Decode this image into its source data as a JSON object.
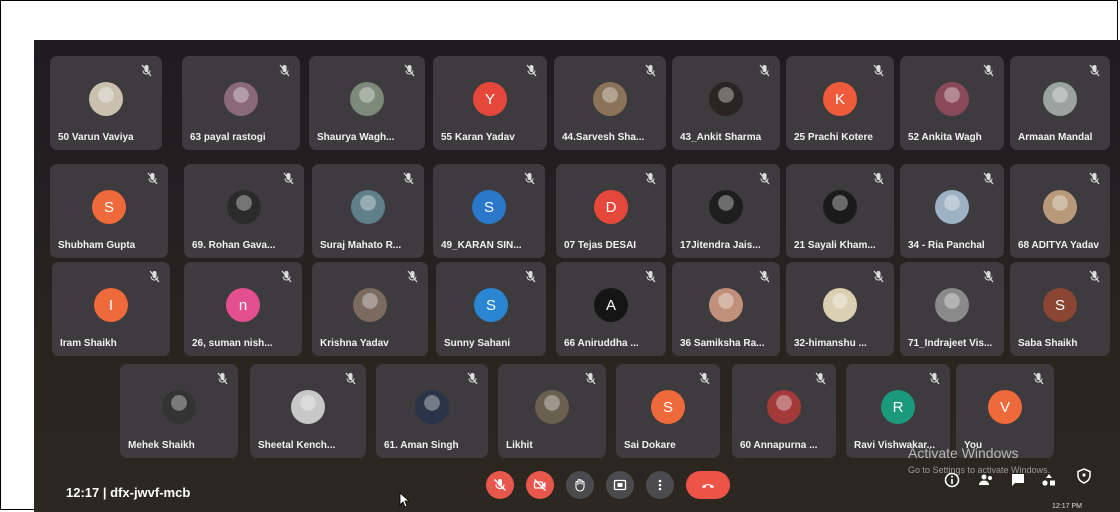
{
  "meeting": {
    "time_code": "12:17  |  dfx-jwvf-mcb"
  },
  "participants": [
    {
      "name": "50 Varun Vaviya",
      "avatar": "photo",
      "color": "#c9c0b0"
    },
    {
      "name": "63 payal rastogi",
      "avatar": "photo",
      "color": "#8a6a78"
    },
    {
      "name": "Shaurya Wagh...",
      "avatar": "photo",
      "color": "#7d8a7a"
    },
    {
      "name": "55 Karan Yadav",
      "avatar": "Y",
      "color": "#e5483b"
    },
    {
      "name": "44.Sarvesh Sha...",
      "avatar": "photo",
      "color": "#8a7358"
    },
    {
      "name": "43_Ankit Sharma",
      "avatar": "photo",
      "color": "#2a2424"
    },
    {
      "name": "25 Prachi Kotere",
      "avatar": "K",
      "color": "#ee5a3c"
    },
    {
      "name": "52 Ankita Wagh",
      "avatar": "photo",
      "color": "#8a4a5a"
    },
    {
      "name": "Armaan Mandal",
      "avatar": "photo",
      "color": "#9aa3a0"
    },
    {
      "name": "Shubham Gupta",
      "avatar": "S",
      "color": "#ee6a3a"
    },
    {
      "name": "69. Rohan Gava...",
      "avatar": "photo",
      "color": "#2b2b2b"
    },
    {
      "name": "Suraj Mahato R...",
      "avatar": "photo",
      "color": "#5f7f89"
    },
    {
      "name": "49_KARAN SIN...",
      "avatar": "S",
      "color": "#2a78c9"
    },
    {
      "name": "07 Tejas DESAI",
      "avatar": "D",
      "color": "#e5483b"
    },
    {
      "name": "17Jitendra Jais...",
      "avatar": "photo",
      "color": "#1e1e1e"
    },
    {
      "name": "21 Sayali Kham...",
      "avatar": "photo",
      "color": "#1a1a1a"
    },
    {
      "name": "34 - Ria Panchal",
      "avatar": "photo",
      "color": "#9db2c4"
    },
    {
      "name": "68 ADITYA Yadav",
      "avatar": "photo",
      "color": "#b89a7a"
    },
    {
      "name": "Iram Shaikh",
      "avatar": "I",
      "color": "#ef6a3a"
    },
    {
      "name": "26, suman nish...",
      "avatar": "n",
      "color": "#e4508f"
    },
    {
      "name": "Krishna Yadav",
      "avatar": "photo",
      "color": "#7a6a60"
    },
    {
      "name": "Sunny Sahani",
      "avatar": "S",
      "color": "#2a86d0"
    },
    {
      "name": "66 Aniruddha ...",
      "avatar": "A",
      "color": "#151515"
    },
    {
      "name": "36 Samiksha Ra...",
      "avatar": "photo",
      "color": "#c0907a"
    },
    {
      "name": "32-himanshu ...",
      "avatar": "photo",
      "color": "#d8d0b0"
    },
    {
      "name": "71_Indrajeet Vis...",
      "avatar": "photo",
      "color": "#8a8a8a"
    },
    {
      "name": "Saba Shaikh",
      "avatar": "S",
      "color": "#8a4632"
    },
    {
      "name": "Mehek Shaikh",
      "avatar": "photo",
      "color": "#333333"
    },
    {
      "name": "Sheetal Kench...",
      "avatar": "photo",
      "color": "#c8c8c8"
    },
    {
      "name": "61. Aman Singh",
      "avatar": "photo",
      "color": "#2a3448"
    },
    {
      "name": "Likhit",
      "avatar": "photo",
      "color": "#6a6050"
    },
    {
      "name": "Sai Dokare",
      "avatar": "S",
      "color": "#ef6a3a"
    },
    {
      "name": "60 Annapurna ...",
      "avatar": "photo",
      "color": "#a33a3a"
    },
    {
      "name": "Ravi Vishwakar...",
      "avatar": "R",
      "color": "#1a9a7a"
    },
    {
      "name": "You",
      "avatar": "V",
      "color": "#ef6a3a"
    }
  ],
  "controls": [
    {
      "name": "mic-off-button",
      "color": "#e8574b",
      "icon": "mic-off-icon"
    },
    {
      "name": "camera-off-button",
      "color": "#e8574b",
      "icon": "camera-off-icon"
    },
    {
      "name": "raise-hand-button",
      "color": "#4b4a4c",
      "icon": "hand-icon"
    },
    {
      "name": "present-button",
      "color": "#4b4a4c",
      "icon": "present-icon"
    },
    {
      "name": "more-options-button",
      "color": "#4b4a4c",
      "icon": "more-vertical-icon"
    },
    {
      "name": "leave-call-button",
      "color": "#ee5348",
      "icon": "end-call-icon"
    }
  ],
  "os_overlay": {
    "activate_title": "Activate Windows",
    "activate_sub": "Go to Settings to activate Windows.",
    "clock": "12:17 PM"
  }
}
